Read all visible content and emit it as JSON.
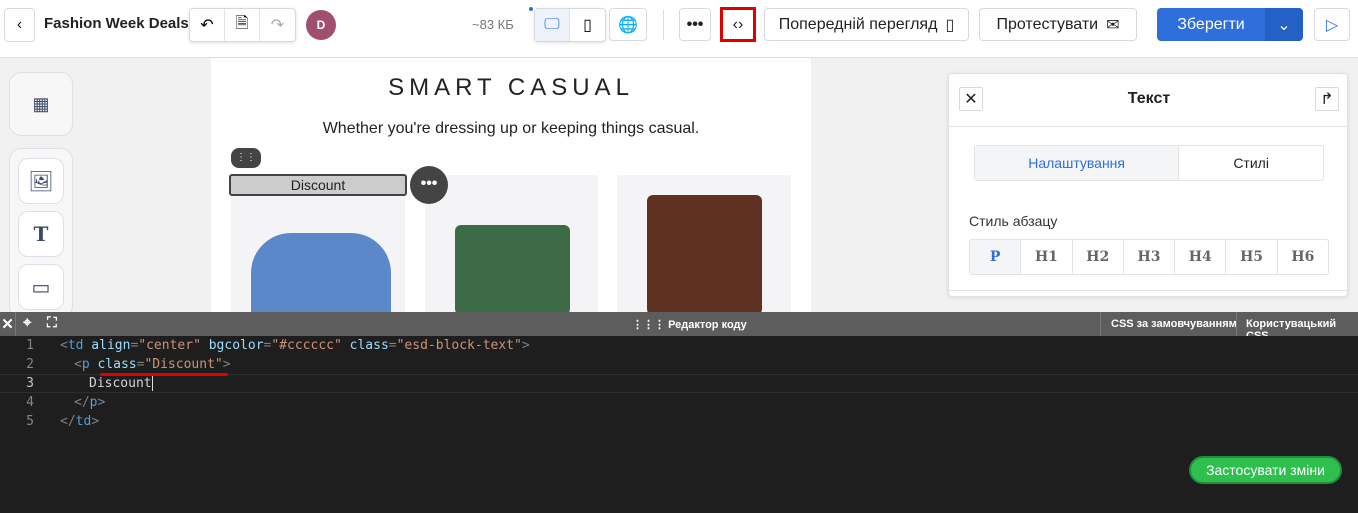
{
  "header": {
    "title": "Fashion Week Deals",
    "avatar": "D",
    "size": "~83 КБ",
    "preview": "Попередній перегляд",
    "test": "Протестувати",
    "save": "Зберегти"
  },
  "email": {
    "heading": "SMART CASUAL",
    "subtitle": "Whether you're dressing up or keeping things casual.",
    "selected_text": "Discount"
  },
  "panel": {
    "title": "Текст",
    "tabs": [
      "Налаштування",
      "Стилі"
    ],
    "paragraph_label": "Стиль абзацу",
    "styles": [
      "P",
      "H1",
      "H2",
      "H3",
      "H4",
      "H5",
      "H6"
    ]
  },
  "editor": {
    "title": "Редактор коду",
    "default_css": "CSS за замовчуванням",
    "custom_css": "Користувацький CSS",
    "apply": "Застосувати зміни",
    "lines": [
      "1",
      "2",
      "3",
      "4",
      "5"
    ],
    "code": {
      "l1a": "<",
      "l1tag": "td",
      "l1b": " align",
      "l1c": "=",
      "l1d": "\"center\"",
      "l1e": " bgcolor",
      "l1f": "\"#cccccc\"",
      "l1g": " class",
      "l1h": "\"esd-block-text\"",
      "l1i": ">",
      "l2tag": "p",
      "l2attr": "class",
      "l2val": "\"Discount\"",
      "l3": "Discount",
      "l4": "p",
      "l5": "td"
    }
  },
  "colors": {
    "accent": "#2f6fdb",
    "apply": "#2fbf4f",
    "highlight": "#e00000"
  }
}
